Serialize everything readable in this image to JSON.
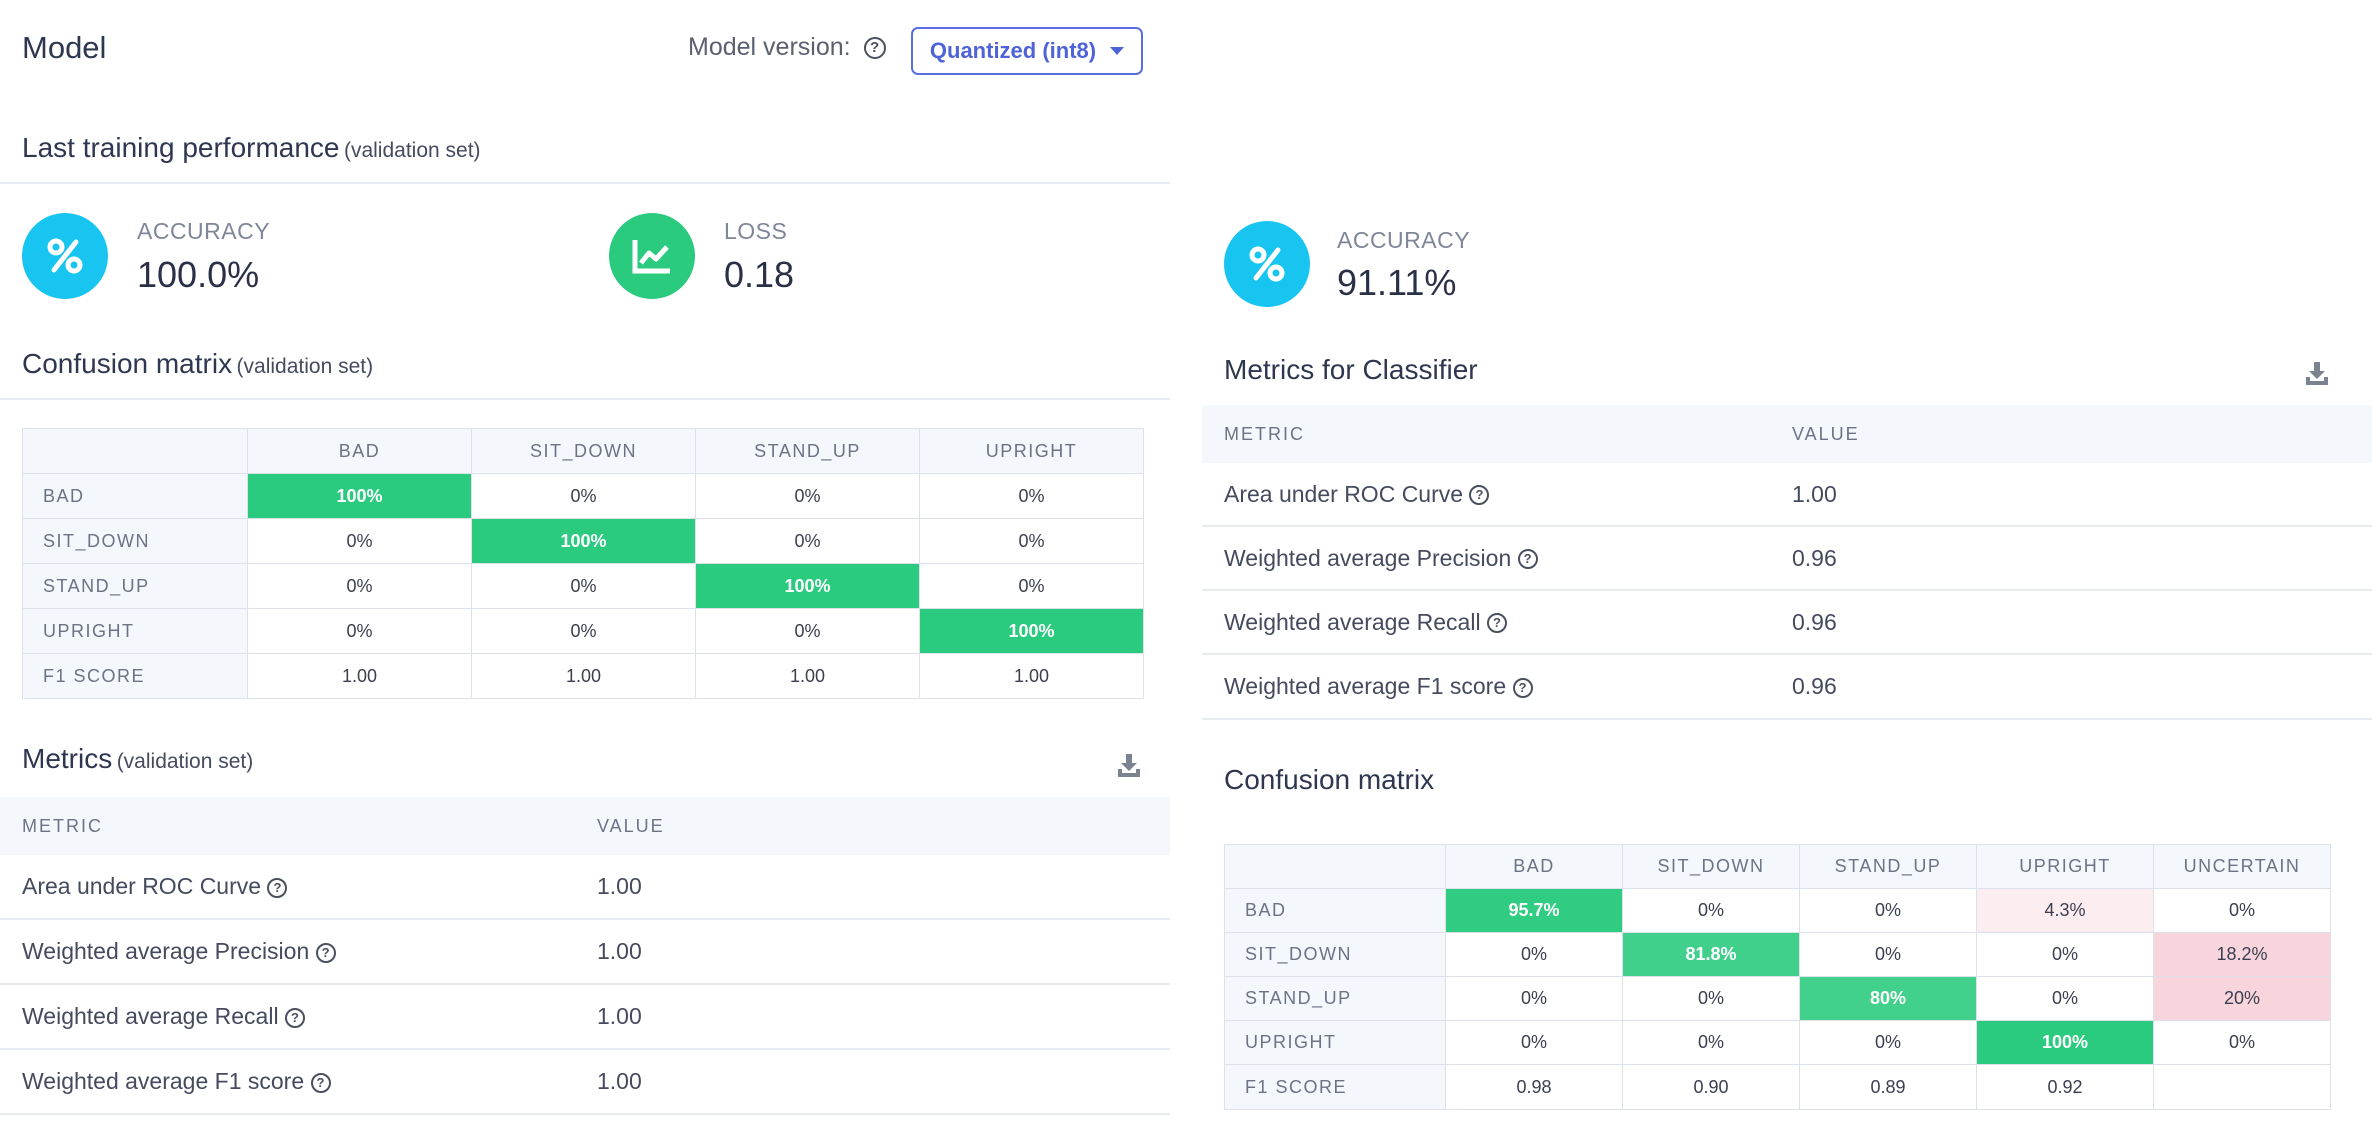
{
  "header": {
    "title": "Model",
    "version_label": "Model version:",
    "version_value": "Quantized (int8)"
  },
  "training": {
    "title": "Last training performance",
    "subtitle": "(validation set)",
    "accuracy_label": "ACCURACY",
    "accuracy_value": "100.0%",
    "loss_label": "LOSS",
    "loss_value": "0.18"
  },
  "left_cm": {
    "title": "Confusion matrix",
    "subtitle": "(validation set)",
    "columns": [
      "BAD",
      "SIT_DOWN",
      "STAND_UP",
      "UPRIGHT"
    ],
    "rows": [
      {
        "label": "BAD",
        "cells": [
          "100%",
          "0%",
          "0%",
          "0%"
        ],
        "levels": [
          1,
          0,
          0,
          0
        ]
      },
      {
        "label": "SIT_DOWN",
        "cells": [
          "0%",
          "100%",
          "0%",
          "0%"
        ],
        "levels": [
          0,
          1,
          0,
          0
        ]
      },
      {
        "label": "STAND_UP",
        "cells": [
          "0%",
          "0%",
          "100%",
          "0%"
        ],
        "levels": [
          0,
          0,
          1,
          0
        ]
      },
      {
        "label": "UPRIGHT",
        "cells": [
          "0%",
          "0%",
          "0%",
          "100%"
        ],
        "levels": [
          0,
          0,
          0,
          1
        ]
      }
    ],
    "f1_label": "F1 SCORE",
    "f1": [
      "1.00",
      "1.00",
      "1.00",
      "1.00"
    ]
  },
  "left_metrics": {
    "title": "Metrics",
    "subtitle": "(validation set)",
    "col_metric": "METRIC",
    "col_value": "VALUE",
    "rows": [
      {
        "name": "Area under ROC Curve",
        "value": "1.00"
      },
      {
        "name": "Weighted average Precision",
        "value": "1.00"
      },
      {
        "name": "Weighted average Recall",
        "value": "1.00"
      },
      {
        "name": "Weighted average F1 score",
        "value": "1.00"
      }
    ]
  },
  "right": {
    "accuracy_label": "ACCURACY",
    "accuracy_value": "91.11%",
    "metrics_title": "Metrics for Classifier",
    "col_metric": "METRIC",
    "col_value": "VALUE",
    "metrics": [
      {
        "name": "Area under ROC Curve",
        "value": "1.00"
      },
      {
        "name": "Weighted average Precision",
        "value": "0.96"
      },
      {
        "name": "Weighted average Recall",
        "value": "0.96"
      },
      {
        "name": "Weighted average F1 score",
        "value": "0.96"
      }
    ],
    "cm_title": "Confusion matrix",
    "cm_columns": [
      "BAD",
      "SIT_DOWN",
      "STAND_UP",
      "UPRIGHT",
      "UNCERTAIN"
    ],
    "cm_rows": [
      {
        "label": "BAD",
        "cells": [
          "95.7%",
          "0%",
          "0%",
          "4.3%",
          "0%"
        ],
        "kinds": [
          "g",
          "",
          "",
          "r",
          ""
        ],
        "levels": [
          0.957,
          0,
          0,
          0.043,
          0
        ]
      },
      {
        "label": "SIT_DOWN",
        "cells": [
          "0%",
          "81.8%",
          "0%",
          "0%",
          "18.2%"
        ],
        "kinds": [
          "",
          "g",
          "",
          "",
          "r"
        ],
        "levels": [
          0,
          0.818,
          0,
          0,
          0.182
        ]
      },
      {
        "label": "STAND_UP",
        "cells": [
          "0%",
          "0%",
          "80%",
          "0%",
          "20%"
        ],
        "kinds": [
          "",
          "",
          "g",
          "",
          "r"
        ],
        "levels": [
          0,
          0,
          0.8,
          0,
          0.2
        ]
      },
      {
        "label": "UPRIGHT",
        "cells": [
          "0%",
          "0%",
          "0%",
          "100%",
          "0%"
        ],
        "kinds": [
          "",
          "",
          "",
          "g",
          ""
        ],
        "levels": [
          0,
          0,
          0,
          1,
          0
        ]
      }
    ],
    "f1_label": "F1 SCORE",
    "f1": [
      "0.98",
      "0.90",
      "0.89",
      "0.92",
      ""
    ]
  },
  "colors": {
    "green": "#2bcb7f",
    "cyan": "#17c5f0",
    "accent": "#4f63d8",
    "red_tint": "#f7d7dd"
  },
  "icons": {
    "percent": "percent-icon",
    "chart": "line-chart-icon",
    "download": "download-icon",
    "help": "help-icon",
    "caret": "chevron-down-icon"
  }
}
